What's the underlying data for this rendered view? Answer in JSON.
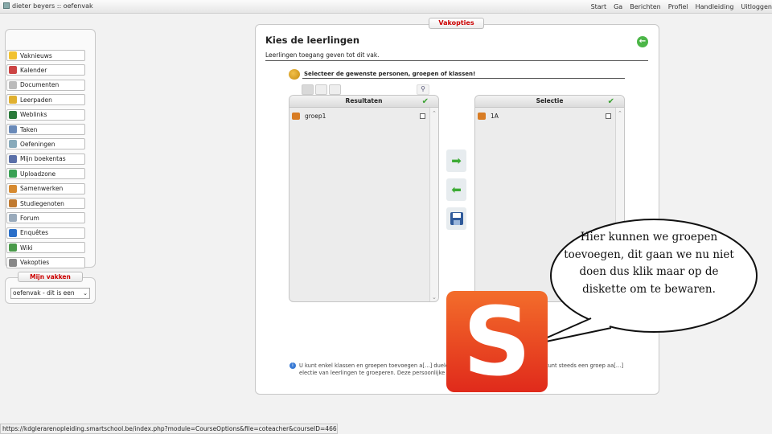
{
  "topbar": {
    "title": "dieter beyers :: oefenvak",
    "nav": [
      "Start",
      "Ga",
      "Berichten",
      "Profiel",
      "Handleiding",
      "Uitloggen"
    ]
  },
  "sidebar": {
    "items": [
      {
        "label": "Vaknieuws",
        "icon": "star-icon",
        "color": "#f2c230"
      },
      {
        "label": "Kalender",
        "icon": "calendar-icon",
        "color": "#c44"
      },
      {
        "label": "Documenten",
        "icon": "document-icon",
        "color": "#bbb"
      },
      {
        "label": "Leerpaden",
        "icon": "path-icon",
        "color": "#e0b030"
      },
      {
        "label": "Weblinks",
        "icon": "globe-icon",
        "color": "#2a7a3a"
      },
      {
        "label": "Taken",
        "icon": "tasks-icon",
        "color": "#6a8ab8"
      },
      {
        "label": "Oefeningen",
        "icon": "exercise-icon",
        "color": "#8ab"
      },
      {
        "label": "Mijn boekentas",
        "icon": "bookbag-icon",
        "color": "#5a6fa8"
      },
      {
        "label": "Uploadzone",
        "icon": "upload-icon",
        "color": "#3aa155"
      },
      {
        "label": "Samenwerken",
        "icon": "collaborate-icon",
        "color": "#d68a30"
      },
      {
        "label": "Studiegenoten",
        "icon": "classmates-icon",
        "color": "#c07a30"
      },
      {
        "label": "Forum",
        "icon": "forum-icon",
        "color": "#9ab"
      },
      {
        "label": "Enquêtes",
        "icon": "survey-icon",
        "color": "#2a6fc8"
      },
      {
        "label": "Wiki",
        "icon": "wiki-icon",
        "color": "#4a9a4a"
      },
      {
        "label": "Vakopties",
        "icon": "wrench-icon",
        "color": "#888"
      }
    ]
  },
  "mijn_vakken": {
    "title": "Mijn vakken",
    "selected": "oefenvak - dit is een"
  },
  "panel": {
    "tab": "Vakopties",
    "title": "Kies de leerlingen",
    "subtitle": "Leerlingen toegang geven tot dit vak.",
    "select_header": "Selecteer de gewenste personen, groepen of klassen!",
    "results": {
      "header": "Resultaten",
      "rows": [
        "groep1"
      ]
    },
    "selection": {
      "header": "Selectie",
      "rows": [
        "1A"
      ]
    },
    "info": "U kunt enkel klassen en groepen toevoegen a[…] duele personen kunt u niet selecteren. U kunt steeds een groep aa[…] electie van leerlingen te groeperen. Deze persoonlijke groep kunt u[…] mer."
  },
  "status_url": "https://kdglerarenopleiding.smartschool.be/index.php?module=CourseOptions&file=coteacher&courseID=466",
  "callout": "Hier kunnen we groepen toevoegen, dit gaan we nu niet doen dus klik maar op de diskette om te bewaren.",
  "logo_letter": "S"
}
